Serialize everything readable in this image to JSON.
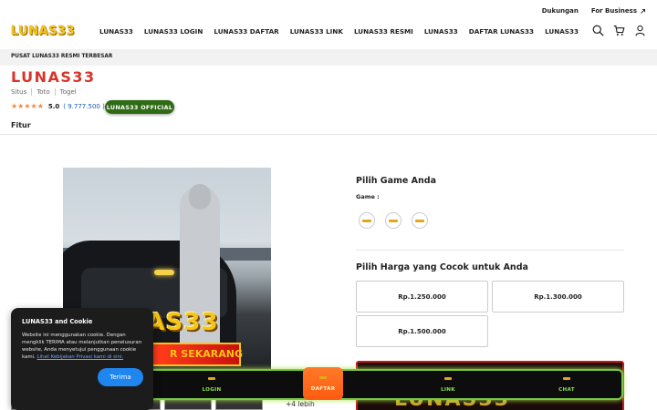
{
  "util": {
    "support": "Dukungan",
    "business": "For Business",
    "business_icon": "external-link-icon"
  },
  "brand": {
    "logo_text": "LUNAS33",
    "logo_color": "#f5c518"
  },
  "nav": [
    "LUNAS33",
    "LUNAS33 LOGIN",
    "LUNAS33 DAFTAR",
    "LUNAS33 LINK",
    "LUNAS33 RESMI",
    "LUNAS33",
    "DAFTAR LUNAS33",
    "LUNAS33"
  ],
  "header_icons": [
    "search-icon",
    "cart-icon",
    "user-icon"
  ],
  "breadcrumb": "PUSAT LUNAS33 RESMI TERBESAR",
  "product": {
    "title": "LUNAS33",
    "title_color": "#d8342a",
    "tags": [
      "Situs",
      "Toto",
      "Togel"
    ],
    "stars": "★★★★★",
    "stars_count": 5,
    "score": "5.0",
    "reviews": "( 9.777.500 )",
    "official_badge": "LUNAS33 OFFICIAL",
    "badge_color": "#2f6b14"
  },
  "section_tab": "Fitur",
  "gallery": {
    "hero_brand": "LUNAS33",
    "hero_band": "R SEKARANG",
    "more": "+4 lebih"
  },
  "panel": {
    "choose_game": "Pilih Game Anda",
    "game_label": "Game :",
    "choose_price": "Pilih Harga yang Cocok untuk Anda",
    "prices": [
      "Rp.1.250.000",
      "Rp.1.300.000",
      "Rp.1.500.000"
    ],
    "promo_text": "LUNAS33"
  },
  "cookie": {
    "title": "LUNAS33 and Cookie",
    "body": "Website ini menggunakan cookie. Dengan mengklik TERIMA atau melanjutkan penelusuran website, Anda menyetujui penggunaan cookie kami.",
    "link": "Lihat Kebijakan Privasi kami di sini.",
    "accept": "Terima"
  },
  "bottom_nav": {
    "items": [
      "",
      "LOGIN",
      "DAFTAR",
      "LINK",
      "CHAT"
    ],
    "accent": "#8fe34a",
    "active_color": "#ff6a1a"
  }
}
